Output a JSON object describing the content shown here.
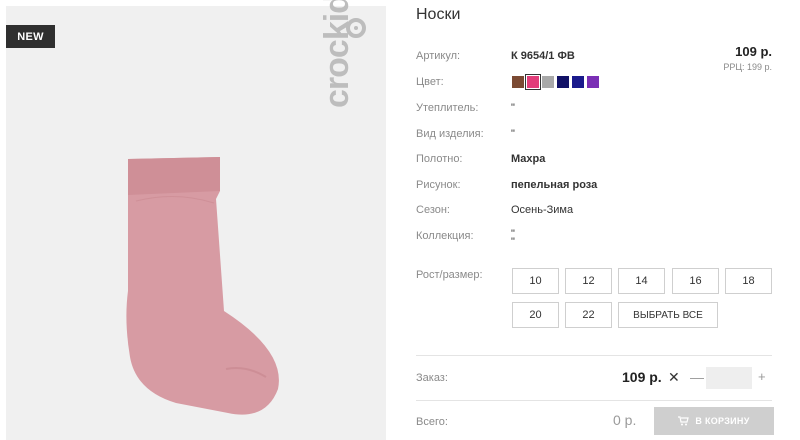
{
  "product": {
    "badge": "NEW",
    "brand": "crockid",
    "title": "Носки"
  },
  "details": [
    {
      "label": "Артикул:",
      "value": "К 9654/1 ФВ"
    },
    {
      "label": "Цвет:",
      "value": ""
    },
    {
      "label": "Утеплитель:",
      "value": "\""
    },
    {
      "label": "Вид изделия:",
      "value": "\""
    },
    {
      "label": "Полотно:",
      "value": "Махра"
    },
    {
      "label": "Рисунок:",
      "value": "пепельная роза"
    },
    {
      "label": "Сезон:",
      "value": "Осень-Зима"
    },
    {
      "label": "Коллекция:",
      "value": "\"",
      "value2": "\""
    }
  ],
  "price": {
    "main": "109 р.",
    "rrp": "РРЦ: 199 р."
  },
  "colors": [
    "#7b4a33",
    "#e23d7a",
    "#a9a9a9",
    "#111166",
    "#1a1a8c",
    "#7a2fb5"
  ],
  "selected_color_index": 1,
  "sizes": {
    "label": "Рост/размер:",
    "options": [
      "10",
      "12",
      "14",
      "16",
      "18",
      "20",
      "22"
    ],
    "select_all": "ВЫБРАТЬ ВСЕ"
  },
  "order": {
    "label": "Заказ:",
    "price": "109 р.",
    "times": "✕",
    "minus": "—",
    "plus": "+",
    "quantity": ""
  },
  "total": {
    "label": "Всего:",
    "value": "0 р.",
    "cart_button": "В КОРЗИНУ"
  }
}
